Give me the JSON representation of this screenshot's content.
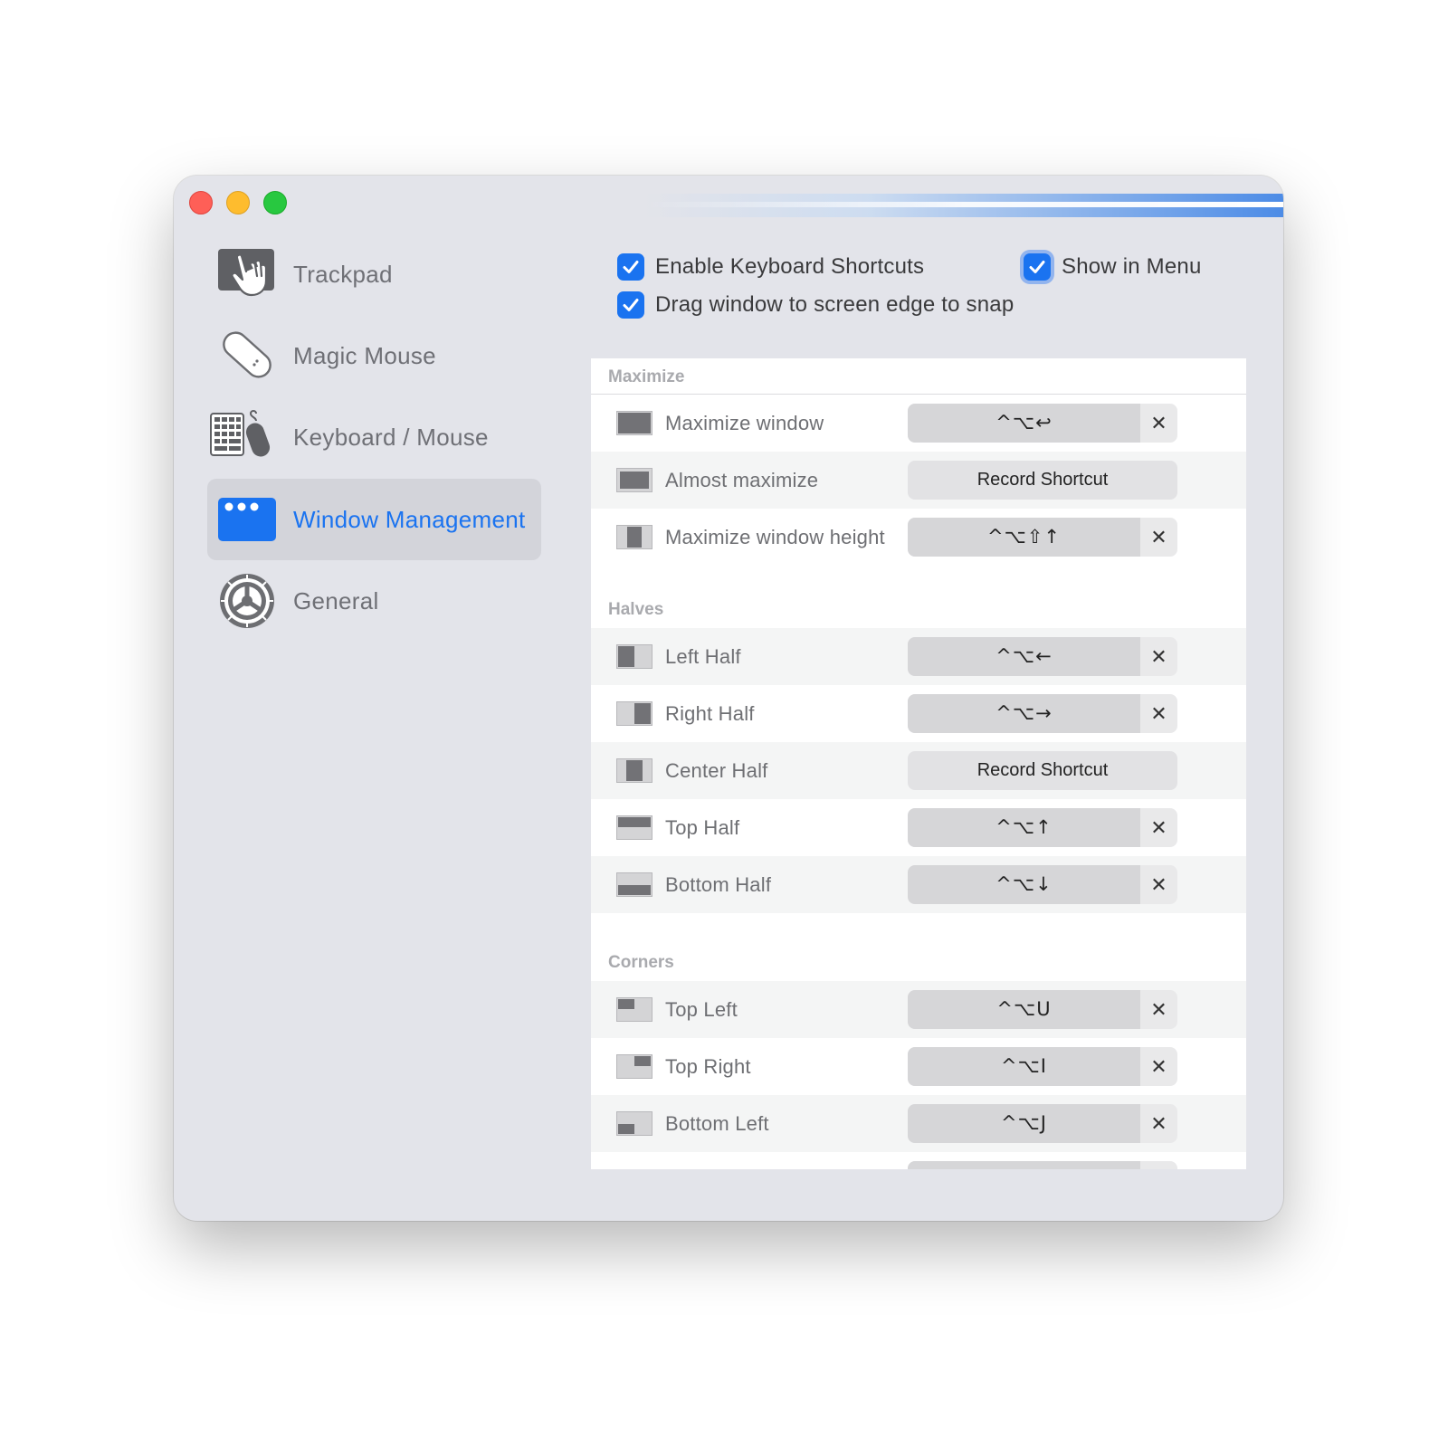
{
  "sidebar": {
    "items": [
      {
        "label": "Trackpad",
        "icon": "trackpad-icon",
        "active": false
      },
      {
        "label": "Magic Mouse",
        "icon": "magic-mouse-icon",
        "active": false
      },
      {
        "label": "Keyboard / Mouse",
        "icon": "keyboard-mouse-icon",
        "active": false
      },
      {
        "label": "Window Management",
        "icon": "window-management-icon",
        "active": true
      },
      {
        "label": "General",
        "icon": "gear-icon",
        "active": false
      }
    ]
  },
  "options": {
    "enable_shortcuts": {
      "label": "Enable Keyboard Shortcuts",
      "checked": true
    },
    "show_in_menu": {
      "label": "Show in Menu",
      "checked": true
    },
    "drag_snap": {
      "label": "Drag window to screen edge to snap",
      "checked": true
    }
  },
  "sections": {
    "maximize": {
      "title": "Maximize",
      "rows": [
        {
          "label": "Maximize window",
          "shortcut": "^⌥↩",
          "thumb": "full"
        },
        {
          "label": "Almost maximize",
          "shortcut": "Record Shortcut",
          "thumb": "almost"
        },
        {
          "label": "Maximize window height",
          "shortcut": "^⌥⇧↑",
          "thumb": "height"
        }
      ]
    },
    "halves": {
      "title": "Halves",
      "rows": [
        {
          "label": "Left Half",
          "shortcut": "^⌥←",
          "thumb": "left"
        },
        {
          "label": "Right Half",
          "shortcut": "^⌥→",
          "thumb": "right"
        },
        {
          "label": "Center Half",
          "shortcut": "Record Shortcut",
          "thumb": "center"
        },
        {
          "label": "Top Half",
          "shortcut": "^⌥↑",
          "thumb": "top"
        },
        {
          "label": "Bottom Half",
          "shortcut": "^⌥↓",
          "thumb": "bottom"
        }
      ]
    },
    "corners": {
      "title": "Corners",
      "rows": [
        {
          "label": "Top Left",
          "shortcut": "^⌥U",
          "thumb": "topleft"
        },
        {
          "label": "Top Right",
          "shortcut": "^⌥I",
          "thumb": "topright"
        },
        {
          "label": "Bottom Left",
          "shortcut": "^⌥J",
          "thumb": "bottomleft"
        }
      ]
    }
  },
  "colors": {
    "accent": "#1a73f0",
    "window_bg": "#e3e4ea",
    "close": "#fe5f57",
    "minimize": "#febc2e",
    "zoom": "#28c840"
  }
}
